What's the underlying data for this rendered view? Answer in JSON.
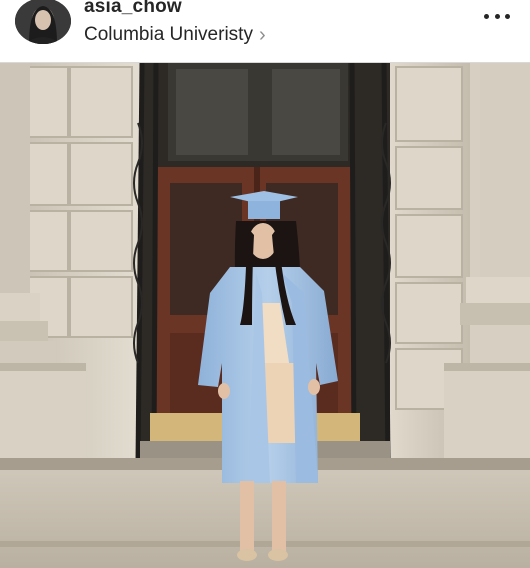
{
  "post": {
    "username": "asia_chow",
    "location": "Columbia Univeristy",
    "location_chevron": "›",
    "more_icon": "more-horizontal-icon",
    "avatar_icon": "profile-avatar",
    "photo_description_icon": "graduation-photo"
  }
}
